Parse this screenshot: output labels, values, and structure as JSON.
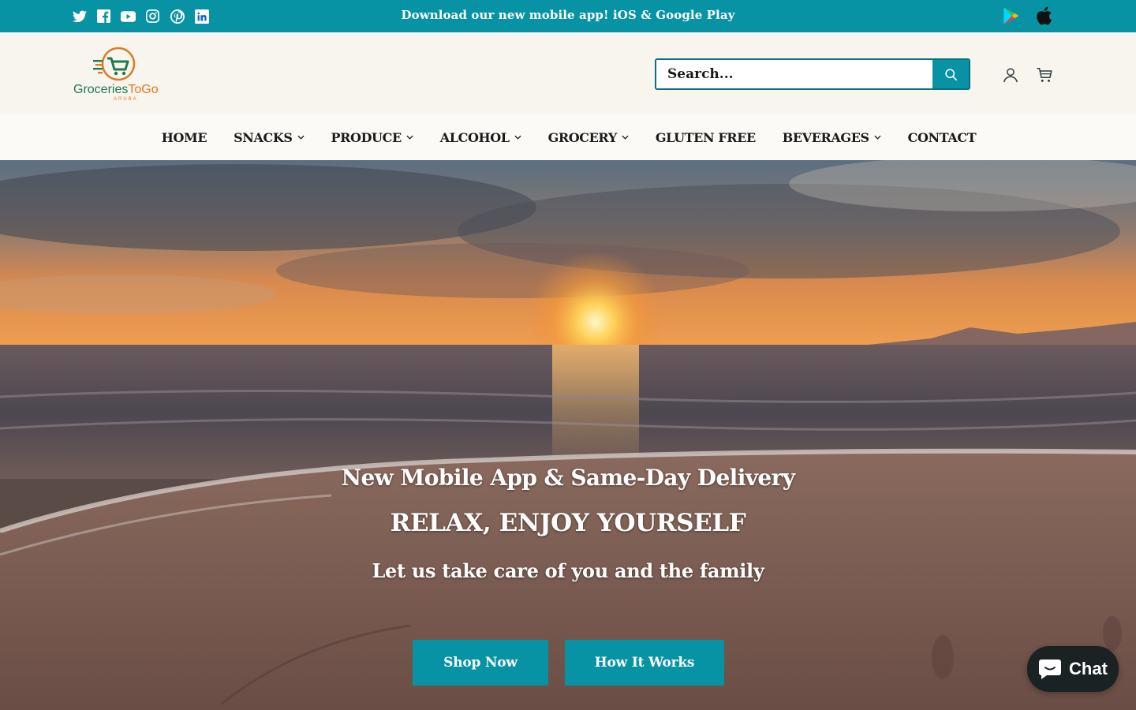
{
  "topbar": {
    "announcement": "Download our new mobile app! iOS & Google Play",
    "social_icons": [
      "twitter-icon",
      "facebook-icon",
      "youtube-icon",
      "instagram-icon",
      "pinterest-icon",
      "linkedin-icon"
    ],
    "app_icons": [
      "google-play-icon",
      "apple-icon"
    ],
    "background": "#0893a4"
  },
  "header": {
    "logo": {
      "word1": "Groceries",
      "word2": "ToGo",
      "sub": "ARUBA"
    },
    "search": {
      "placeholder": "Search..."
    },
    "icons": [
      "account-icon",
      "cart-icon"
    ]
  },
  "nav": {
    "items": [
      {
        "label": "HOME",
        "dropdown": false
      },
      {
        "label": "SNACKS",
        "dropdown": true
      },
      {
        "label": "PRODUCE",
        "dropdown": true
      },
      {
        "label": "ALCOHOL",
        "dropdown": true
      },
      {
        "label": "GROCERY",
        "dropdown": true
      },
      {
        "label": "GLUTEN FREE",
        "dropdown": false
      },
      {
        "label": "BEVERAGES",
        "dropdown": true
      },
      {
        "label": "CONTACT",
        "dropdown": false
      }
    ]
  },
  "hero": {
    "heading": "New Mobile App & Same-Day Delivery",
    "title": "RELAX, ENJOY YOURSELF",
    "subtitle": "Let us take care of you and the family",
    "buttons": {
      "primary": "Shop Now",
      "secondary": "How It Works"
    }
  },
  "chat": {
    "label": "Chat"
  },
  "colors": {
    "accent": "#0893a4",
    "logo_green": "#1f7a4f",
    "logo_orange": "#e07a1f"
  }
}
